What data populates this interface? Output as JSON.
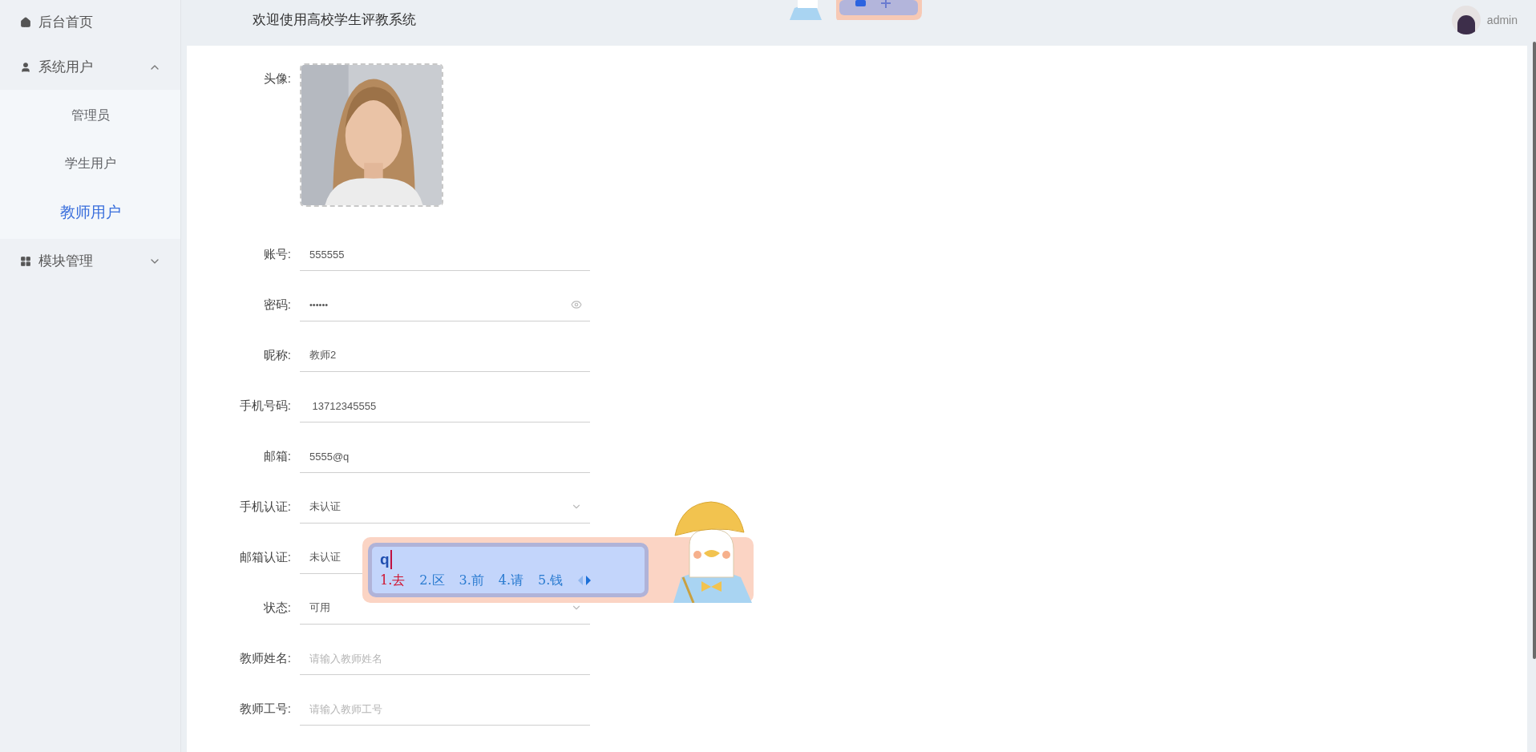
{
  "sidebar": {
    "items": [
      {
        "label": "后台首页"
      },
      {
        "label": "系统用户",
        "expanded": true,
        "children": [
          {
            "label": "管理员",
            "selected": false
          },
          {
            "label": "学生用户",
            "selected": false
          },
          {
            "label": "教师用户",
            "selected": true
          }
        ]
      },
      {
        "label": "模块管理",
        "expanded": false
      }
    ]
  },
  "header": {
    "title": "欢迎使用高校学生评教系统",
    "user": "admin"
  },
  "form": {
    "avatar_label": "头像:",
    "fields": [
      {
        "label": "账号:",
        "kind": "text",
        "value": "555555"
      },
      {
        "label": "密码:",
        "kind": "password",
        "value": "••••••"
      },
      {
        "label": "昵称:",
        "kind": "text",
        "value": "教师2"
      },
      {
        "label": "手机号码:",
        "kind": "text",
        "value": " 13712345555"
      },
      {
        "label": "邮箱:",
        "kind": "text",
        "value": "5555@q"
      },
      {
        "label": "手机认证:",
        "kind": "select",
        "value": "未认证"
      },
      {
        "label": "邮箱认证:",
        "kind": "select",
        "value": "未认证"
      },
      {
        "label": "状态:",
        "kind": "select",
        "value": "可用"
      },
      {
        "label": "教师姓名:",
        "kind": "text",
        "placeholder": "请输入教师姓名"
      },
      {
        "label": "教师工号:",
        "kind": "text",
        "placeholder": "请输入教师工号"
      }
    ]
  },
  "ime": {
    "input": "q",
    "candidates": [
      {
        "label": "1.去",
        "selected": true
      },
      {
        "label": "2.区",
        "selected": false
      },
      {
        "label": "3.前",
        "selected": false
      },
      {
        "label": "4.请",
        "selected": false
      },
      {
        "label": "5.钱",
        "selected": false
      }
    ]
  }
}
